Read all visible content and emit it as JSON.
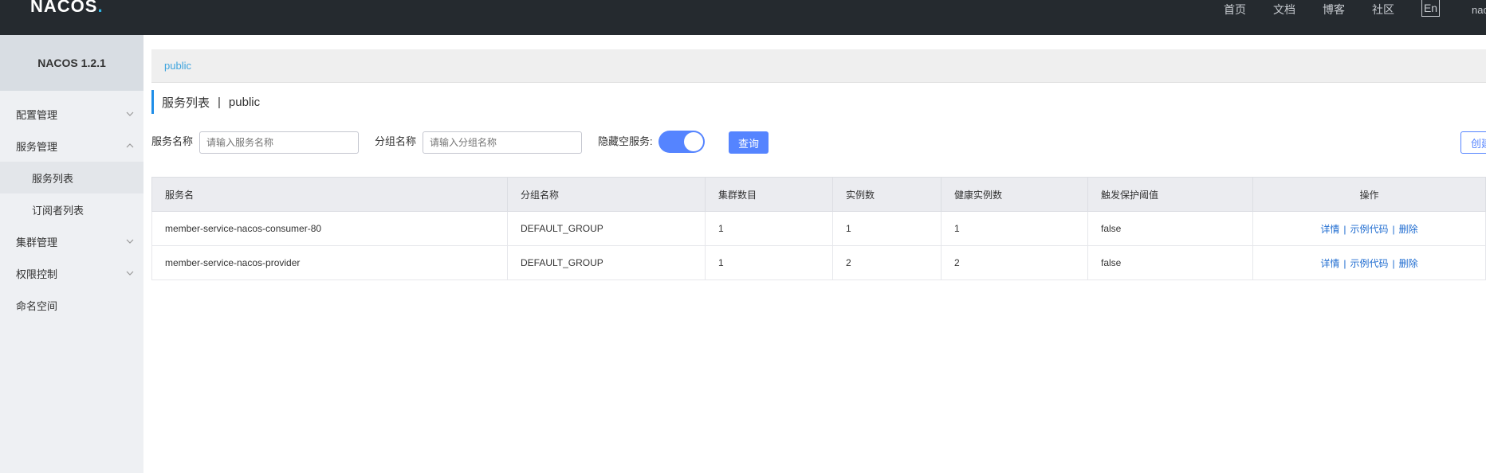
{
  "header": {
    "logo": "NACOS",
    "logo_dot": ".",
    "nav": [
      "首页",
      "文档",
      "博客",
      "社区"
    ],
    "lang": "En",
    "user": "nacos"
  },
  "sidebar": {
    "title": "NACOS 1.2.1",
    "items": [
      {
        "label": "配置管理",
        "expanded": false
      },
      {
        "label": "服务管理",
        "expanded": true
      },
      {
        "label": "服务列表",
        "sub": true,
        "active": true
      },
      {
        "label": "订阅者列表",
        "sub": true
      },
      {
        "label": "集群管理",
        "expanded": false
      },
      {
        "label": "权限控制",
        "expanded": false
      },
      {
        "label": "命名空间"
      }
    ]
  },
  "namespace_bar": {
    "current": "public"
  },
  "page_title": {
    "title": "服务列表",
    "separator": "|",
    "namespace": "public"
  },
  "filters": {
    "service_name_label": "服务名称",
    "service_name_placeholder": "请输入服务名称",
    "group_name_label": "分组名称",
    "group_name_placeholder": "请输入分组名称",
    "hide_empty_label": "隐藏空服务:",
    "hide_empty_on": true,
    "query_button": "查询",
    "create_button": "创建服务"
  },
  "table": {
    "columns": [
      "服务名",
      "分组名称",
      "集群数目",
      "实例数",
      "健康实例数",
      "触发保护阈值",
      "操作"
    ],
    "rows": [
      {
        "name": "member-service-nacos-consumer-80",
        "group": "DEFAULT_GROUP",
        "clusters": "1",
        "instances": "1",
        "healthy": "1",
        "threshold": "false"
      },
      {
        "name": "member-service-nacos-provider",
        "group": "DEFAULT_GROUP",
        "clusters": "1",
        "instances": "2",
        "healthy": "2",
        "threshold": "false"
      }
    ],
    "ops": {
      "detail": "详情",
      "sample": "示例代码",
      "delete": "删除",
      "sep": "|"
    }
  },
  "colors": {
    "topbar": "#252a2f",
    "accent": "#5584ff",
    "link": "#1f6cd0"
  }
}
